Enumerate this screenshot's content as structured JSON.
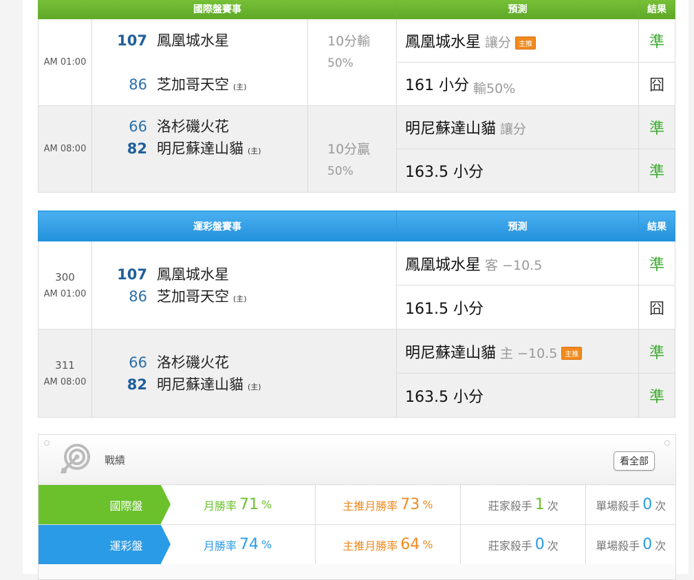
{
  "intl": {
    "header": {
      "match": "國際盤賽事",
      "prediction": "預測",
      "result": "結果"
    },
    "games": [
      {
        "time": "AM 01:00",
        "teams": [
          {
            "num": "107",
            "name": "鳳凰城水星",
            "home": ""
          },
          {
            "num": "86",
            "name": "芝加哥天空",
            "home": "(主)"
          }
        ],
        "handicap": {
          "line1": "10分輸",
          "line2": "50%"
        },
        "predictions": [
          {
            "main": "鳳凰城水星",
            "sub": "讓分",
            "badge": "主推",
            "result": "準"
          },
          {
            "main": "161 小分",
            "sub": "輸50%",
            "badge": "",
            "result": "囧"
          }
        ]
      },
      {
        "time": "AM 08:00",
        "teams": [
          {
            "num": "66",
            "name": "洛杉磯火花",
            "home": ""
          },
          {
            "num": "82",
            "name": "明尼蘇達山貓",
            "home": "(主)"
          }
        ],
        "handicap": {
          "line1": "10分贏",
          "line2": "50%"
        },
        "predictions": [
          {
            "main": "明尼蘇達山貓",
            "sub": "讓分",
            "badge": "",
            "result": "準"
          },
          {
            "main": "163.5 小分",
            "sub": "",
            "badge": "",
            "result": "準"
          }
        ]
      }
    ]
  },
  "lottery": {
    "header": {
      "match": "運彩盤賽事",
      "prediction": "預測",
      "result": "結果"
    },
    "games": [
      {
        "code": "300",
        "time": "AM 01:00",
        "teams": [
          {
            "num": "107",
            "name": "鳳凰城水星",
            "home": ""
          },
          {
            "num": "86",
            "name": "芝加哥天空",
            "home": "(主)"
          }
        ],
        "predictions": [
          {
            "main": "鳳凰城水星",
            "sub": "客 −10.5",
            "badge": "",
            "result": "準"
          },
          {
            "main": "161.5 小分",
            "sub": "",
            "badge": "",
            "result": "囧"
          }
        ]
      },
      {
        "code": "311",
        "time": "AM 08:00",
        "teams": [
          {
            "num": "66",
            "name": "洛杉磯火花",
            "home": ""
          },
          {
            "num": "82",
            "name": "明尼蘇達山貓",
            "home": "(主)"
          }
        ],
        "predictions": [
          {
            "main": "明尼蘇達山貓",
            "sub": "主 −10.5",
            "badge": "主推",
            "result": "準"
          },
          {
            "main": "163.5 小分",
            "sub": "",
            "badge": "",
            "result": "準"
          }
        ]
      }
    ]
  },
  "stats": {
    "title": "戰績",
    "view_all": "看全部",
    "rows": [
      {
        "label": "國際盤",
        "month_rate_label": "月勝率",
        "month_rate": "71",
        "month_rate_unit": "%",
        "main_rate_label": "主推月勝率",
        "main_rate": "73",
        "main_rate_unit": "%",
        "banker_label": "莊家殺手",
        "banker": "1",
        "banker_unit": "次",
        "single_label": "單場殺手",
        "single": "0",
        "single_unit": "次"
      },
      {
        "label": "運彩盤",
        "month_rate_label": "月勝率",
        "month_rate": "74",
        "month_rate_unit": "%",
        "main_rate_label": "主推月勝率",
        "main_rate": "64",
        "main_rate_unit": "%",
        "banker_label": "莊家殺手",
        "banker": "0",
        "banker_unit": "次",
        "single_label": "單場殺手",
        "single": "0",
        "single_unit": "次"
      }
    ]
  },
  "colors": {
    "green": "#6ac12c",
    "blue": "#2a9be6",
    "orange": "#f08a1d",
    "ok": "#3daa2f"
  }
}
